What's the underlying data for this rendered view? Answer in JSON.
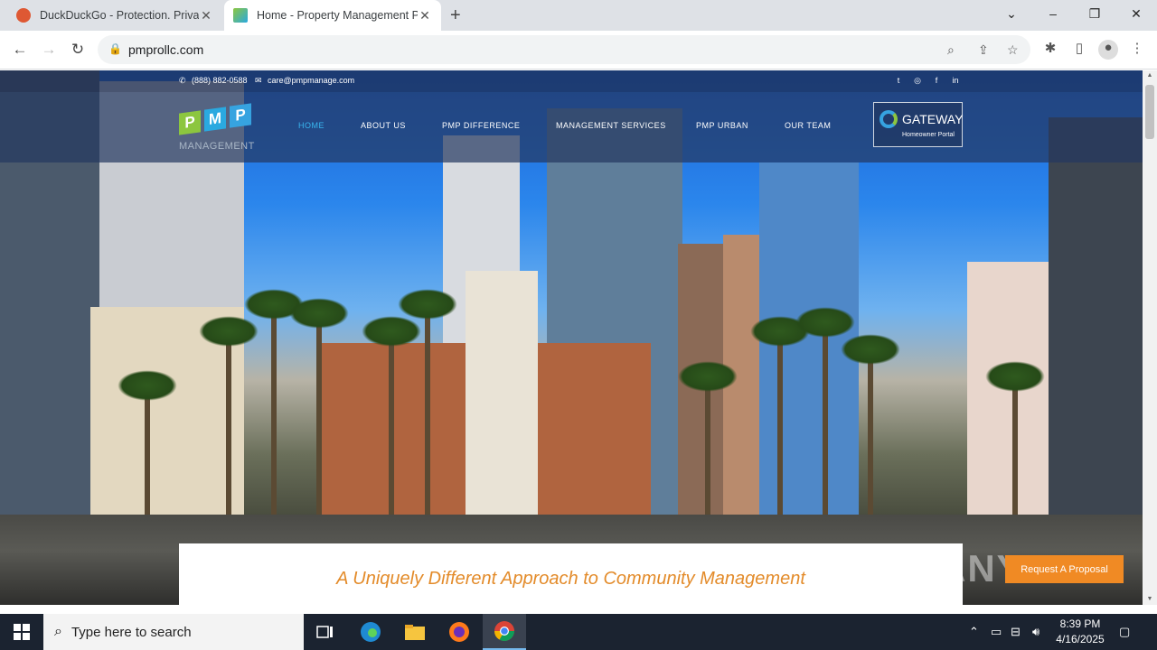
{
  "browser": {
    "tabs": [
      {
        "title": "DuckDuckGo - Protection. Privacy",
        "active": false
      },
      {
        "title": "Home - Property Management Professionals",
        "active": true
      }
    ],
    "new_tab": "+",
    "url": "pmprollc.com",
    "window_controls": {
      "minimize": "–",
      "restore": "❐",
      "close": "✕",
      "tab_search": "⌄"
    }
  },
  "site": {
    "topbar": {
      "phone": "(888) 882-0588",
      "email": "care@pmpmanage.com"
    },
    "social": [
      "twitter",
      "instagram",
      "facebook",
      "linkedin"
    ],
    "logo": {
      "letters": [
        "P",
        "M",
        "P"
      ],
      "subtitle": "MANAGEMENT",
      "colors": [
        "#8cc63f",
        "#2aa9e0",
        "#36a3e0"
      ]
    },
    "nav": [
      {
        "label": "HOME",
        "active": true
      },
      {
        "label": "ABOUT US",
        "active": false
      },
      {
        "label": "PMP DIFFERENCE",
        "active": false
      },
      {
        "label": "MANAGEMENT SERVICES",
        "active": false
      },
      {
        "label": "PMP URBAN",
        "active": false
      },
      {
        "label": "OUR TEAM",
        "active": false
      }
    ],
    "gateway": {
      "title": "GATEWAY",
      "subtitle": "Homeowner Portal"
    },
    "headline": "A Uniquely Different Approach to Community Management",
    "proposal_button": "Request A Proposal",
    "accent": "#e38b2a",
    "watermark": "ANY RUN"
  },
  "taskbar": {
    "search_placeholder": "Type here to search",
    "time": "8:39 PM",
    "date": "4/16/2025"
  }
}
